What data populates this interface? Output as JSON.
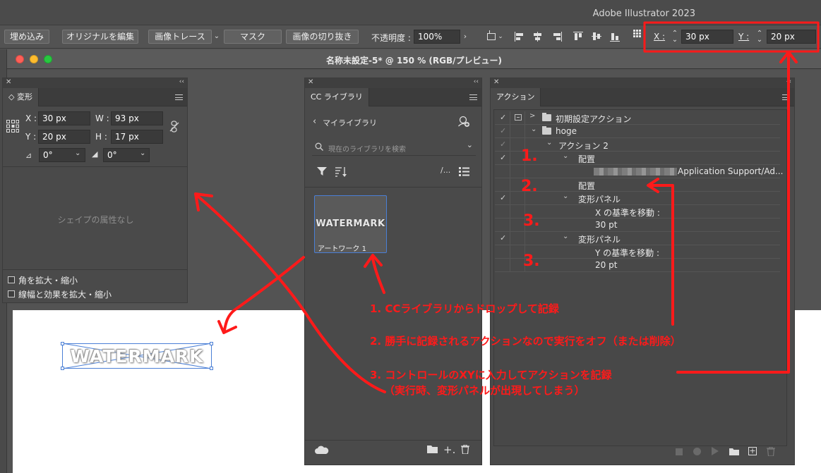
{
  "app_title": "Adobe Illustrator 2023",
  "control_bar": {
    "embed_label": "埋め込み",
    "edit_original_label": "オリジナルを編集",
    "image_trace_label": "画像トレース",
    "mask_label": "マスク",
    "crop_label": "画像の切り抜き",
    "opacity_label": "不透明度 :",
    "opacity_value": "100%",
    "x_label": "X :",
    "x_value": "30 px",
    "y_label": "Y :",
    "y_value": "20 px"
  },
  "document": {
    "title": "名称未設定-5* @ 150 % (RGB/プレビュー)"
  },
  "transform_panel": {
    "tab": "変形",
    "x_label": "X :",
    "x_value": "30 px",
    "w_label": "W :",
    "w_value": "93 px",
    "y_label": "Y :",
    "y_value": "20 px",
    "h_label": "H :",
    "h_value": "17 px",
    "rotate_value": "0°",
    "shear_value": "0°",
    "no_shape_text": "シェイプの属性なし",
    "scale_corners_label": "角を拡大・縮小",
    "scale_strokes_label": "線幅と効果を拡大・縮小"
  },
  "cc_library_panel": {
    "tab": "CC ライブラリ",
    "library_name": "マイライブラリ",
    "search_placeholder": "現在のライブラリを検索",
    "item_thumb_text": "WATERMARK",
    "item_name": "アートワーク 1"
  },
  "actions_panel": {
    "tab": "アクション",
    "rows": [
      {
        "text": "初期設定アクション"
      },
      {
        "text": "hoge"
      },
      {
        "text": "アクション 2"
      },
      {
        "text": "配置"
      },
      {
        "text": "Application Support/Ad..."
      },
      {
        "text": "配置"
      },
      {
        "text": "変形パネル"
      },
      {
        "text": "X の基準を移動 :"
      },
      {
        "text": "30 pt"
      },
      {
        "text": "変形パネル"
      },
      {
        "text": "Y の基準を移動 :"
      },
      {
        "text": "20 pt"
      }
    ]
  },
  "canvas": {
    "artwork_text": "WATERMARK"
  },
  "annotations": {
    "num1": "1.",
    "num2": "2.",
    "num3a": "3.",
    "num3b": "3.",
    "note1": "1. CCライブラリからドロップして記録",
    "note2": "2. 勝手に記録されるアクションなので実行をオフ（または削除）",
    "note3": "3. コントロールのXYに入力してアクションを記録",
    "note3_sub": "（実行時、変形パネルが出現してしまう）"
  },
  "colors": {
    "annotation_red": "#ff1a1a",
    "selection_blue": "#4a7fd6",
    "panel_bg": "#4a4a4a"
  }
}
